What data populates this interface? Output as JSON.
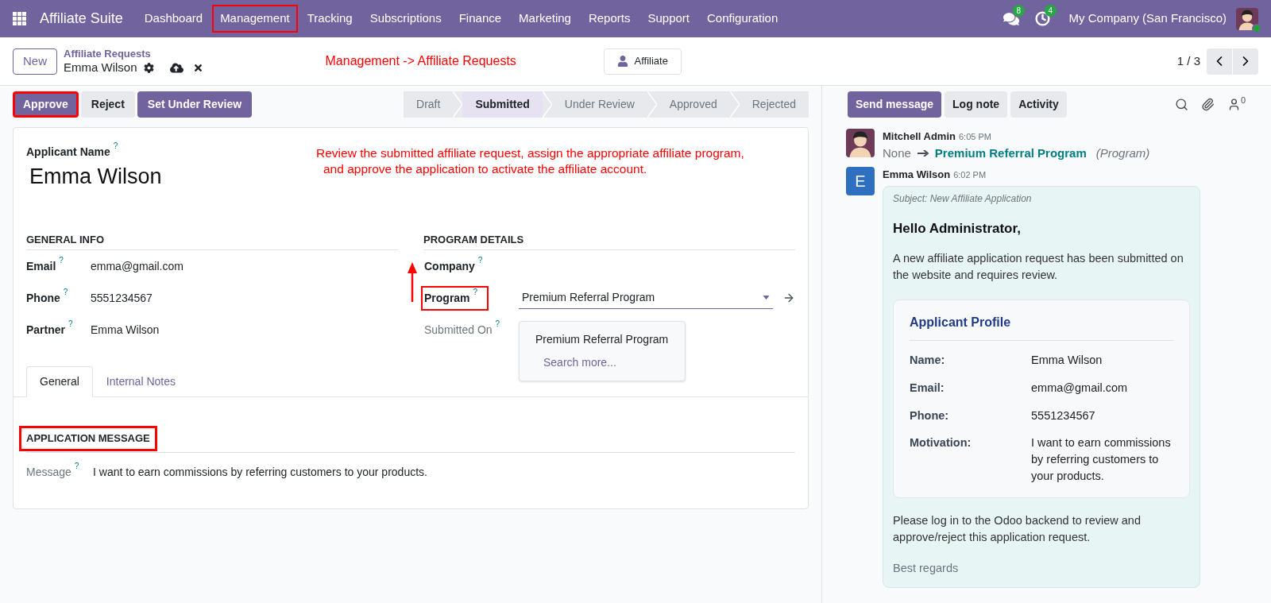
{
  "navbar": {
    "app_name": "Affiliate Suite",
    "menu": [
      {
        "label": "Dashboard",
        "highlighted": false
      },
      {
        "label": "Management",
        "highlighted": true
      },
      {
        "label": "Tracking",
        "highlighted": false
      },
      {
        "label": "Subscriptions",
        "highlighted": false
      },
      {
        "label": "Finance",
        "highlighted": false
      },
      {
        "label": "Marketing",
        "highlighted": false
      },
      {
        "label": "Reports",
        "highlighted": false
      },
      {
        "label": "Support",
        "highlighted": false
      },
      {
        "label": "Configuration",
        "highlighted": false
      }
    ],
    "messages_badge": "8",
    "activities_badge": "4",
    "company": "My Company (San Francisco)",
    "online": true
  },
  "control_panel": {
    "new_button": "New",
    "breadcrumb": "Affiliate Requests",
    "record_name": "Emma Wilson",
    "smart_button": "Affiliate",
    "pager": "1 / 3"
  },
  "annotations": {
    "path": "Management -> Affiliate Requests",
    "instruction": [
      "Review the submitted affiliate request, assign the appropriate affiliate program,",
      "and approve the application to activate the affiliate account."
    ]
  },
  "actions": [
    {
      "label": "Approve",
      "kind": "primary",
      "highlighted": true
    },
    {
      "label": "Reject",
      "kind": "secondary",
      "highlighted": false
    },
    {
      "label": "Set Under Review",
      "kind": "primary",
      "highlighted": false
    }
  ],
  "stages": [
    {
      "label": "Draft",
      "selected": false
    },
    {
      "label": "Submitted",
      "selected": true
    },
    {
      "label": "Under Review",
      "selected": false
    },
    {
      "label": "Approved",
      "selected": false
    },
    {
      "label": "Rejected",
      "selected": false
    }
  ],
  "chatter_buttons": [
    {
      "label": "Send message",
      "kind": "primary"
    },
    {
      "label": "Log note",
      "kind": "secondary"
    },
    {
      "label": "Activity",
      "kind": "secondary"
    }
  ],
  "followers_count": "0",
  "form": {
    "applicant_label": "Applicant Name",
    "applicant_help": "?",
    "applicant_name": "Emma Wilson",
    "general_info": {
      "title": "GENERAL INFO",
      "fields": [
        {
          "label": "Email",
          "help": "?",
          "value": "emma@gmail.com"
        },
        {
          "label": "Phone",
          "help": "?",
          "value": "5551234567"
        },
        {
          "label": "Partner",
          "help": "?",
          "value": "Emma Wilson"
        }
      ]
    },
    "program_details": {
      "title": "PROGRAM DETAILS",
      "fields": [
        {
          "label": "Company",
          "help": "?",
          "kind": "text",
          "highlighted": false,
          "readonly": false
        },
        {
          "label": "Program",
          "help": "?",
          "kind": "many2one",
          "value": "Premium Referral Program",
          "highlighted": true,
          "readonly": false
        },
        {
          "label": "Submitted On",
          "help": "?",
          "kind": "text",
          "highlighted": false,
          "readonly": true
        }
      ],
      "dropdown": {
        "options": [
          "Premium Referral Program"
        ],
        "search_more": "Search more..."
      }
    },
    "tabs": [
      {
        "label": "General",
        "selected": true
      },
      {
        "label": "Internal Notes",
        "selected": false
      }
    ],
    "message_section": {
      "title": "APPLICATION MESSAGE",
      "highlighted": true,
      "label": "Message",
      "help": "?",
      "value": "I want to earn commissions by referring customers to your products."
    }
  },
  "chatter": [
    {
      "kind": "tracking",
      "author": "Mitchell Admin",
      "time": "6:05 PM",
      "old_value": "None",
      "new_value": "Premium Referral Program",
      "field": "(Program)"
    },
    {
      "kind": "email",
      "author": "Emma Wilson",
      "time": "6:02 PM",
      "initial": "E",
      "subject": "Subject: New Affiliate Application",
      "greeting": "Hello Administrator,",
      "intro": "A new affiliate application request has been submitted on the website and requires review.",
      "profile": {
        "title": "Applicant Profile",
        "rows": [
          {
            "label": "Name:",
            "value": "Emma Wilson"
          },
          {
            "label": "Email:",
            "value": "emma@gmail.com"
          },
          {
            "label": "Phone:",
            "value": "5551234567"
          },
          {
            "label": "Motivation:",
            "value": "I want to earn commissions by referring customers to your products."
          }
        ]
      },
      "outro": "Please log in to the Odoo backend to review and approve/reject this application request.",
      "closing": "Best regards"
    }
  ]
}
